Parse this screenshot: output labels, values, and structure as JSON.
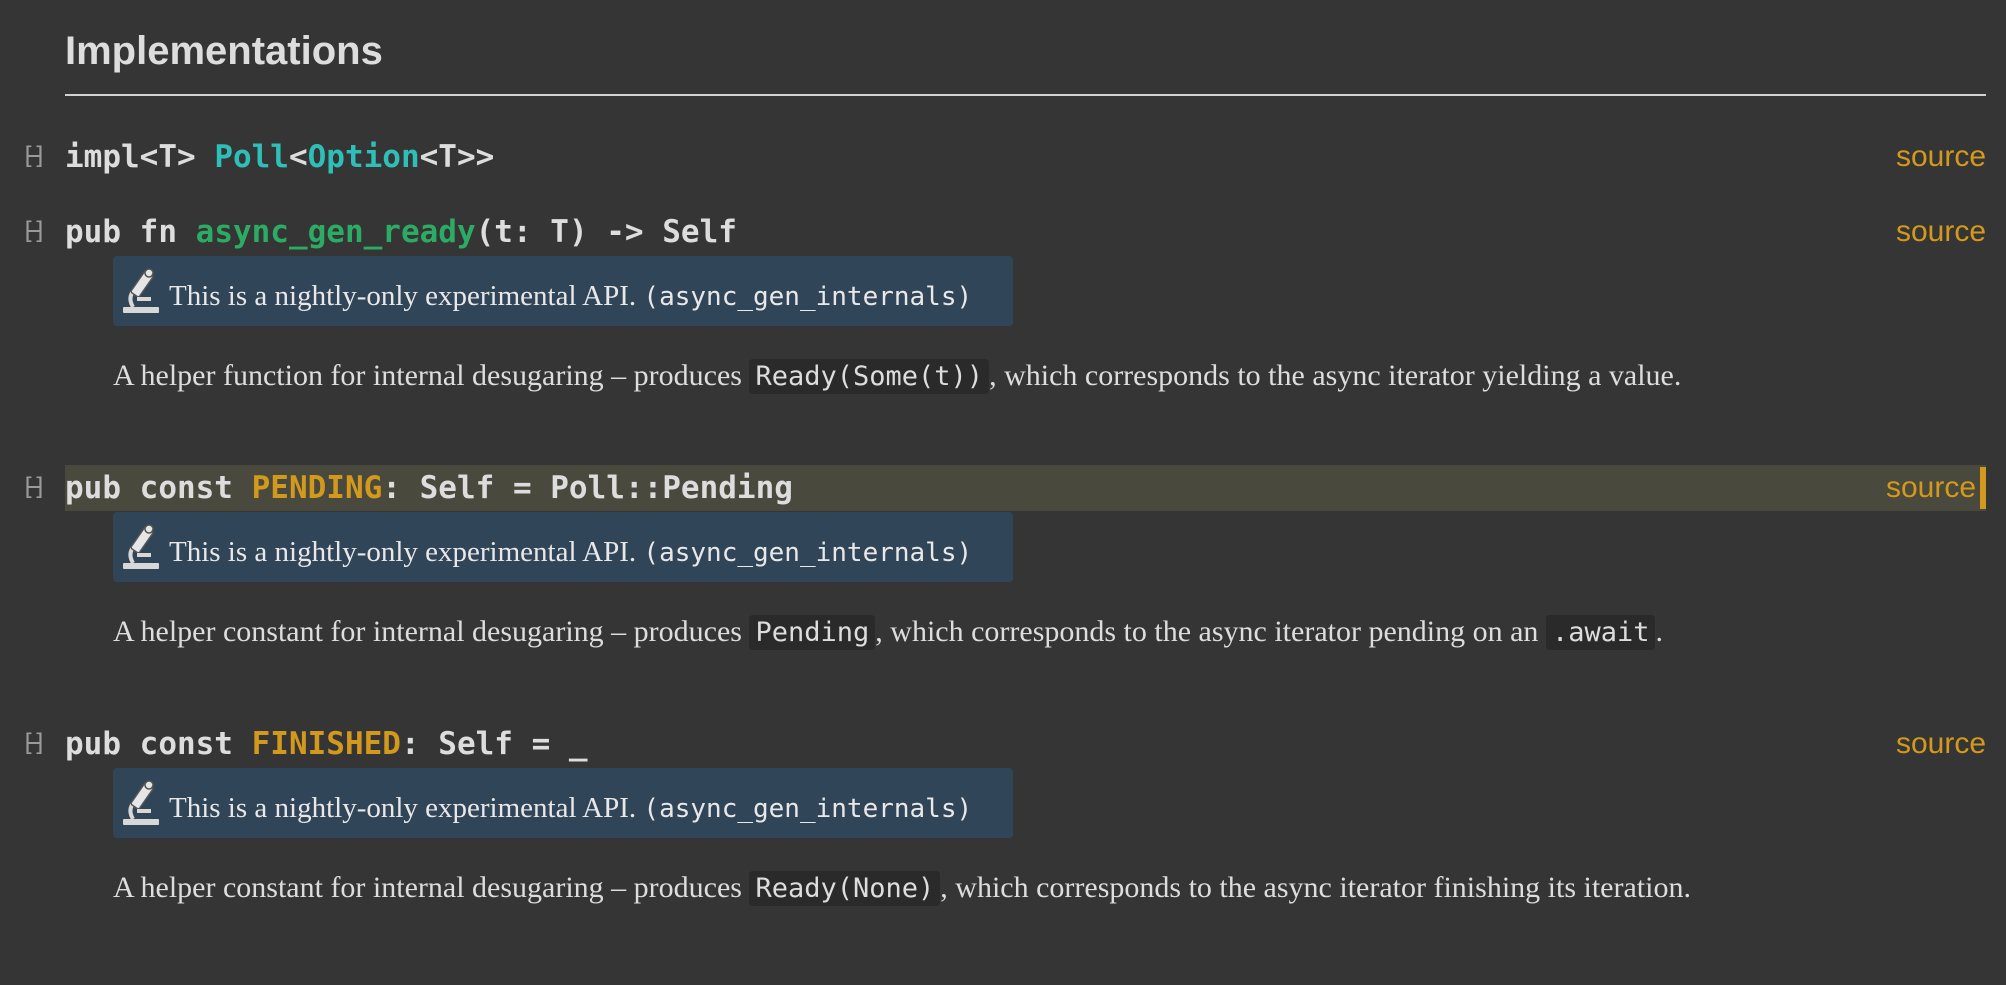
{
  "section": {
    "title": "Implementations"
  },
  "impl": {
    "prefix": "impl<T> ",
    "type_poll": "Poll",
    "lt1": "<",
    "type_option": "Option",
    "suffix": "<T>>",
    "source_label": "source"
  },
  "items": [
    {
      "sig_pre": "pub fn ",
      "name": "async_gen_ready",
      "sig_post": "(t: T) -> Self",
      "name_kind": "fn",
      "source_label": "source",
      "stability": {
        "text": "This is a nightly-only experimental API.",
        "feature": "(async_gen_internals)"
      },
      "doc": {
        "before": "A helper function for internal desugaring – produces ",
        "code1": "Ready(Some(t))",
        "after": ", which corresponds to the async iterator yielding a value."
      }
    },
    {
      "sig_pre": "pub const ",
      "name": "PENDING",
      "sig_post": ": Self = Poll::Pending",
      "name_kind": "const",
      "source_label": "source",
      "highlighted": true,
      "stability": {
        "text": "This is a nightly-only experimental API.",
        "feature": "(async_gen_internals)"
      },
      "doc": {
        "before": "A helper constant for internal desugaring – produces ",
        "code1": "Pending",
        "middle": ", which corresponds to the async iterator pending on an ",
        "code2": ".await",
        "after": "."
      }
    },
    {
      "sig_pre": "pub const ",
      "name": "FINISHED",
      "sig_post": ": Self = _",
      "name_kind": "const",
      "source_label": "source",
      "stability": {
        "text": "This is a nightly-only experimental API.",
        "feature": "(async_gen_internals)"
      },
      "doc": {
        "before": "A helper constant for internal desugaring – produces ",
        "code1": "Ready(None)",
        "after": ", which corresponds to the async iterator finishing its iteration."
      }
    }
  ],
  "colors": {
    "background": "#353535",
    "text": "#dddddd",
    "type": "#2dbfb8",
    "function": "#2bab63",
    "constant": "#d2991d",
    "source_link": "#d2991d",
    "stability_bg": "#314559",
    "highlight_bg": "#494a3d"
  },
  "icons": {
    "toggle": "collapse-toggle-icon",
    "stability": "microscope-icon"
  }
}
